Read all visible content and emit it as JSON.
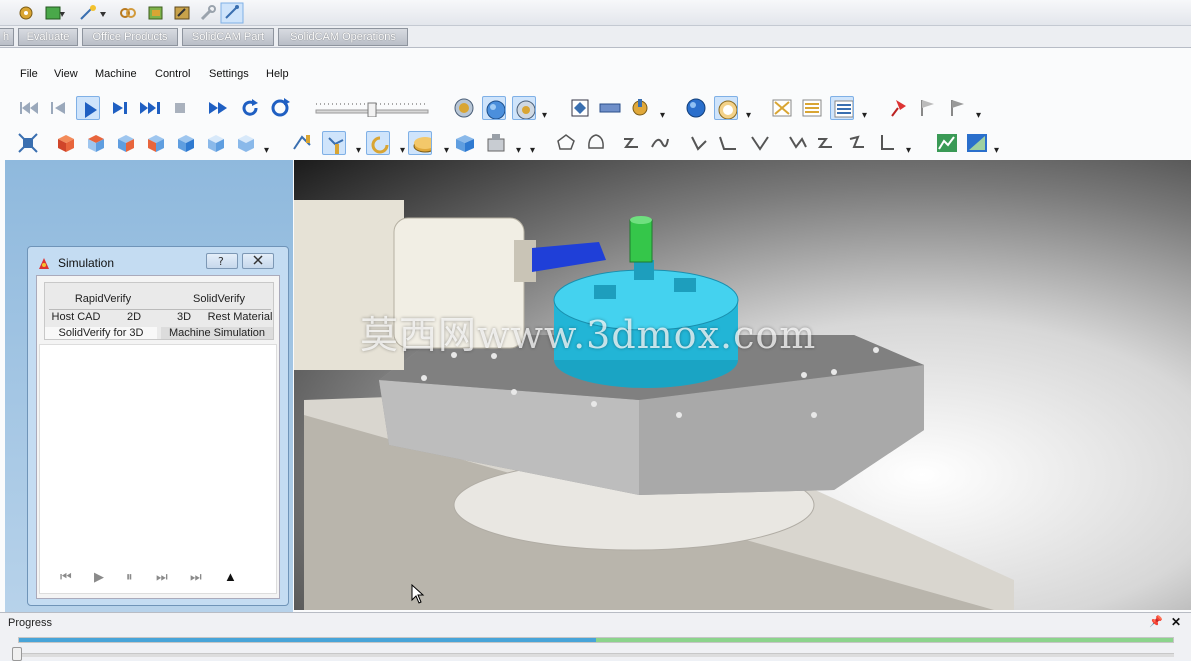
{
  "tabs": [
    "h",
    "Evaluate",
    "Office Products",
    "SolidCAM Part",
    "SolidCAM Operations"
  ],
  "menu": {
    "file": "File",
    "view": "View",
    "machine": "Machine",
    "control": "Control",
    "settings": "Settings",
    "help": "Help"
  },
  "simulation": {
    "title": "Simulation",
    "tabs_row1": [
      "RapidVerify",
      "SolidVerify"
    ],
    "tabs_row2": [
      "Host CAD",
      "2D",
      "3D",
      "Rest Material"
    ],
    "tabs_row3": [
      "SolidVerify for 3D",
      "Machine Simulation"
    ],
    "controls": {
      "rewind": "⏮",
      "play": "▶",
      "pause": "⏸",
      "step": "⏭",
      "end": "⏭",
      "eject": "▲"
    }
  },
  "progress": {
    "label": "Progress",
    "value": 0.5,
    "pin": "📌",
    "close": "✕"
  },
  "watermark": "莫西网www.3dmox.com",
  "colors": {
    "accent": "#47a4d8",
    "chuck": "#33c8e6",
    "tool": "#1f3fd8",
    "holder": "#35c64a"
  }
}
